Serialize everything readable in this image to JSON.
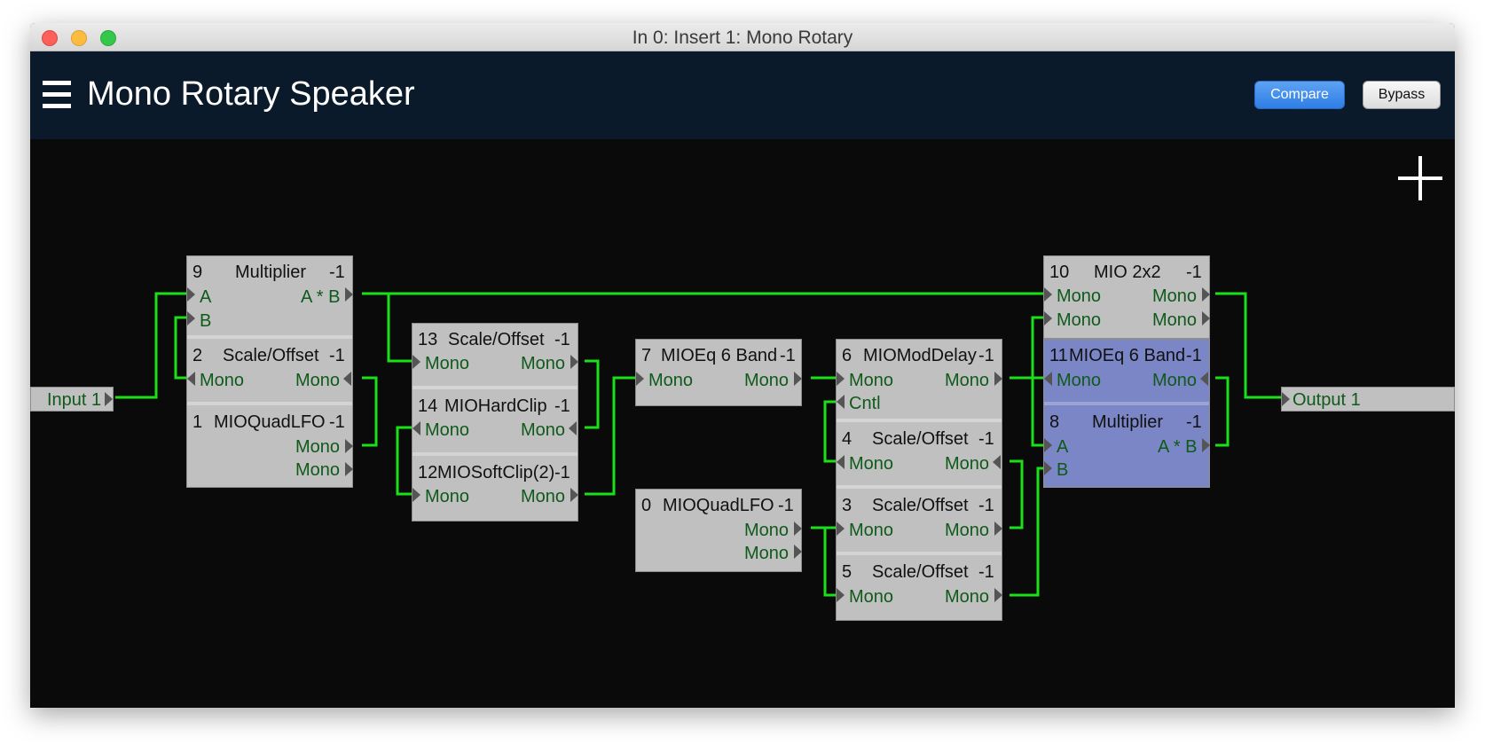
{
  "window": {
    "title": "In 0: Insert 1: Mono Rotary"
  },
  "header": {
    "title": "Mono Rotary Speaker",
    "compare_label": "Compare",
    "bypass_label": "Bypass"
  },
  "io": {
    "input_label": "Input 1",
    "output_label": "Output 1"
  },
  "colors": {
    "wire": "#19e019",
    "module": "#c0c0c0",
    "module_selected": "#7b86c6",
    "port_text": "#0f5a1a"
  },
  "modules": {
    "m9": {
      "id": "9",
      "name": "Multiplier",
      "suffix": "-1",
      "in_a": "A",
      "in_b": "B",
      "out": "A * B"
    },
    "m2": {
      "id": "2",
      "name": "Scale/Offset",
      "suffix": "-1",
      "in": "Mono",
      "out": "Mono"
    },
    "m1": {
      "id": "1",
      "name": "MIOQuadLFO",
      "suffix": "-1",
      "out1": "Mono",
      "out2": "Mono"
    },
    "m13": {
      "id": "13",
      "name": "Scale/Offset",
      "suffix": "-1",
      "in": "Mono",
      "out": "Mono"
    },
    "m14": {
      "id": "14",
      "name": "MIOHardClip",
      "suffix": "-1",
      "in": "Mono",
      "out": "Mono"
    },
    "m12": {
      "id": "12",
      "name": "MIOSoftClip(2)",
      "suffix": "-1",
      "in": "Mono",
      "out": "Mono"
    },
    "m7": {
      "id": "7",
      "name": "MIOEq 6 Band",
      "suffix": "-1",
      "in": "Mono",
      "out": "Mono"
    },
    "m0": {
      "id": "0",
      "name": "MIOQuadLFO",
      "suffix": "-1",
      "out1": "Mono",
      "out2": "Mono"
    },
    "m6": {
      "id": "6",
      "name": "MIOModDelay",
      "suffix": "-1",
      "in": "Mono",
      "cntl": "Cntl",
      "out": "Mono"
    },
    "m4": {
      "id": "4",
      "name": "Scale/Offset",
      "suffix": "-1",
      "in": "Mono",
      "out": "Mono"
    },
    "m3": {
      "id": "3",
      "name": "Scale/Offset",
      "suffix": "-1",
      "in": "Mono",
      "out": "Mono"
    },
    "m5": {
      "id": "5",
      "name": "Scale/Offset",
      "suffix": "-1",
      "in": "Mono",
      "out": "Mono"
    },
    "m10": {
      "id": "10",
      "name": "MIO 2x2",
      "suffix": "-1",
      "in1": "Mono",
      "in2": "Mono",
      "out1": "Mono",
      "out2": "Mono"
    },
    "m11": {
      "id": "11",
      "name": "MIOEq 6 Band",
      "suffix": "-1",
      "in": "Mono",
      "out": "Mono"
    },
    "m8": {
      "id": "8",
      "name": "Multiplier",
      "suffix": "-1",
      "in_a": "A",
      "in_b": "B",
      "out": "A * B"
    }
  }
}
